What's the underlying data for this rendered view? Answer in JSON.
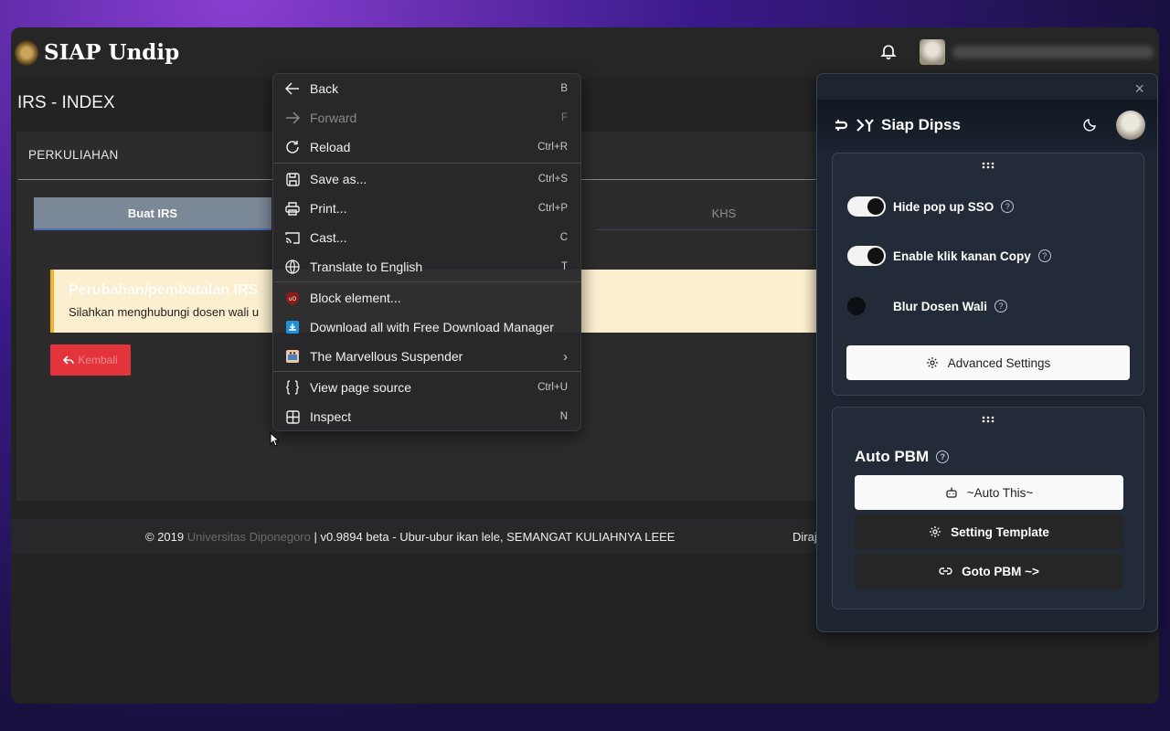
{
  "app": {
    "brand": "SIAP Undip",
    "page_title": "IRS - INDEX"
  },
  "card": {
    "title": "PERKULIAHAN",
    "tabs": [
      "Buat IRS",
      "KHS"
    ],
    "alert_heading": "Perubahan/pembatalan IRS",
    "alert_text": "Silahkan menghubungi dosen wali u",
    "back_button": "Kembali"
  },
  "footer": {
    "copyright": "© 2019 ",
    "university": "Universitas Diponegoro",
    "version": " | v0.9894 beta - Ubur-ubur ikan lele, SEMANGAT KULIAHNYA LEEE",
    "right": "Diraj"
  },
  "context_menu": {
    "items": [
      {
        "label": "Back",
        "shortcut": "B",
        "icon": "arrow-left-icon"
      },
      {
        "label": "Forward",
        "shortcut": "F",
        "icon": "arrow-right-icon",
        "disabled": true
      },
      {
        "label": "Reload",
        "shortcut": "Ctrl+R",
        "icon": "reload-icon"
      },
      {
        "label": "Save as...",
        "shortcut": "Ctrl+S",
        "icon": "save-icon"
      },
      {
        "label": "Print...",
        "shortcut": "Ctrl+P",
        "icon": "print-icon"
      },
      {
        "label": "Cast...",
        "shortcut": "C",
        "icon": "cast-icon"
      },
      {
        "label": "Translate to English",
        "shortcut": "T",
        "icon": "globe-icon"
      },
      {
        "label": "Block element...",
        "shortcut": "",
        "icon": "ublock-icon"
      },
      {
        "label": "Download all with Free Download Manager",
        "shortcut": "",
        "icon": "fdm-icon"
      },
      {
        "label": "The Marvellous Suspender",
        "shortcut": "›",
        "icon": "suspender-icon"
      },
      {
        "label": "View page source",
        "shortcut": "Ctrl+U",
        "icon": "braces-icon"
      },
      {
        "label": "Inspect",
        "shortcut": "N",
        "icon": "inspect-icon"
      }
    ]
  },
  "extension": {
    "title": "Siap Dipss",
    "toggles": [
      {
        "label": "Hide pop up SSO",
        "on": true
      },
      {
        "label": "Enable klik kanan Copy",
        "on": true
      },
      {
        "label": "Blur Dosen Wali",
        "on": false
      }
    ],
    "advanced_button": "Advanced Settings",
    "auto_section_title": "Auto PBM",
    "auto_this_button": "~Auto This~",
    "setting_template_button": "Setting Template",
    "goto_button": "Goto PBM ~>",
    "help_mark": "?"
  }
}
